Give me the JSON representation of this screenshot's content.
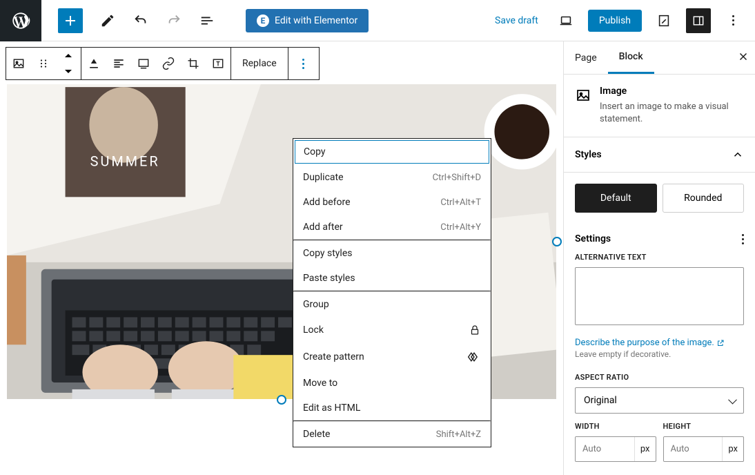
{
  "topbar": {
    "edit_elementor": "Edit with Elementor",
    "save_draft": "Save draft",
    "publish": "Publish"
  },
  "block_toolbar": {
    "replace": "Replace"
  },
  "image_overlay_title": "SUMMER",
  "context_menu": {
    "copy": "Copy",
    "duplicate": {
      "label": "Duplicate",
      "shortcut": "Ctrl+Shift+D"
    },
    "add_before": {
      "label": "Add before",
      "shortcut": "Ctrl+Alt+T"
    },
    "add_after": {
      "label": "Add after",
      "shortcut": "Ctrl+Alt+Y"
    },
    "copy_styles": "Copy styles",
    "paste_styles": "Paste styles",
    "group": "Group",
    "lock": "Lock",
    "create_pattern": "Create pattern",
    "move_to": "Move to",
    "edit_html": "Edit as HTML",
    "delete": {
      "label": "Delete",
      "shortcut": "Shift+Alt+Z"
    }
  },
  "sidebar": {
    "tab_page": "Page",
    "tab_block": "Block",
    "block_name": "Image",
    "block_desc": "Insert an image to make a visual statement.",
    "styles_label": "Styles",
    "style_default": "Default",
    "style_rounded": "Rounded",
    "settings_label": "Settings",
    "alt_label": "ALTERNATIVE TEXT",
    "alt_link": "Describe the purpose of the image.",
    "alt_note": "Leave empty if decorative.",
    "aspect_label": "ASPECT RATIO",
    "aspect_value": "Original",
    "width_label": "WIDTH",
    "height_label": "HEIGHT",
    "dim_placeholder": "Auto",
    "dim_unit": "px"
  }
}
